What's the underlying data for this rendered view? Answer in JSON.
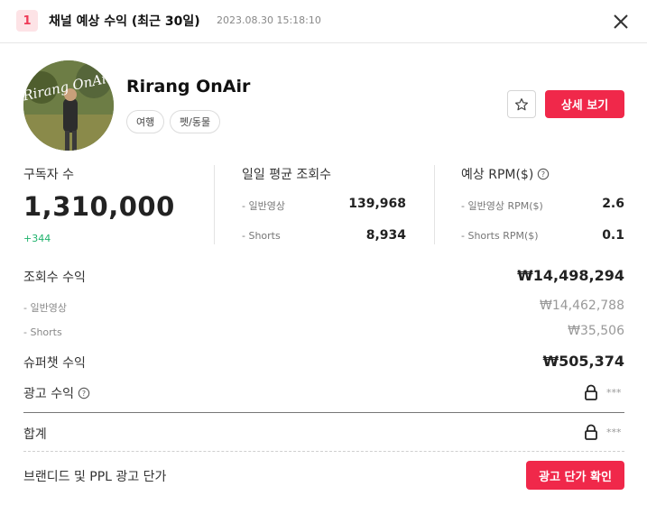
{
  "header": {
    "rank": "1",
    "title": "채널 예상 수익 (최근 30일)",
    "timestamp": "2023.08.30 15:18:10"
  },
  "channel": {
    "avatar_text": "Rirang OnAir",
    "name": "Rirang OnAir",
    "tags": [
      "여행",
      "펫/동물"
    ],
    "detail_button": "상세 보기"
  },
  "stats": {
    "subscribers": {
      "label": "구독자 수",
      "value": "1,310,000",
      "delta": "+344"
    },
    "daily_views": {
      "label": "일일 평균 조회수",
      "rows": [
        {
          "label": "- 일반영상",
          "value": "139,968"
        },
        {
          "label": "- Shorts",
          "value": "8,934"
        }
      ]
    },
    "rpm": {
      "label": "예상 RPM($)",
      "rows": [
        {
          "label": "- 일반영상 RPM($)",
          "value": "2.6"
        },
        {
          "label": "- Shorts RPM($)",
          "value": "0.1"
        }
      ]
    }
  },
  "revenue": {
    "views_revenue": {
      "label": "조회수 수익",
      "value": "₩14,498,294"
    },
    "regular": {
      "label": "- 일반영상",
      "value": "₩14,462,788"
    },
    "shorts": {
      "label": "- Shorts",
      "value": "₩35,506"
    },
    "superchat": {
      "label": "슈퍼챗 수익",
      "value": "₩505,374"
    },
    "ad_revenue": {
      "label": "광고 수익",
      "value": "***"
    },
    "total": {
      "label": "합계",
      "value": "***"
    },
    "brand_ppl": {
      "label": "브랜디드 및 PPL 광고 단가",
      "button": "광고 단가 확인"
    }
  },
  "colors": {
    "accent": "#f0284a",
    "positive": "#1db26b",
    "badge_bg": "#fde3e6"
  }
}
